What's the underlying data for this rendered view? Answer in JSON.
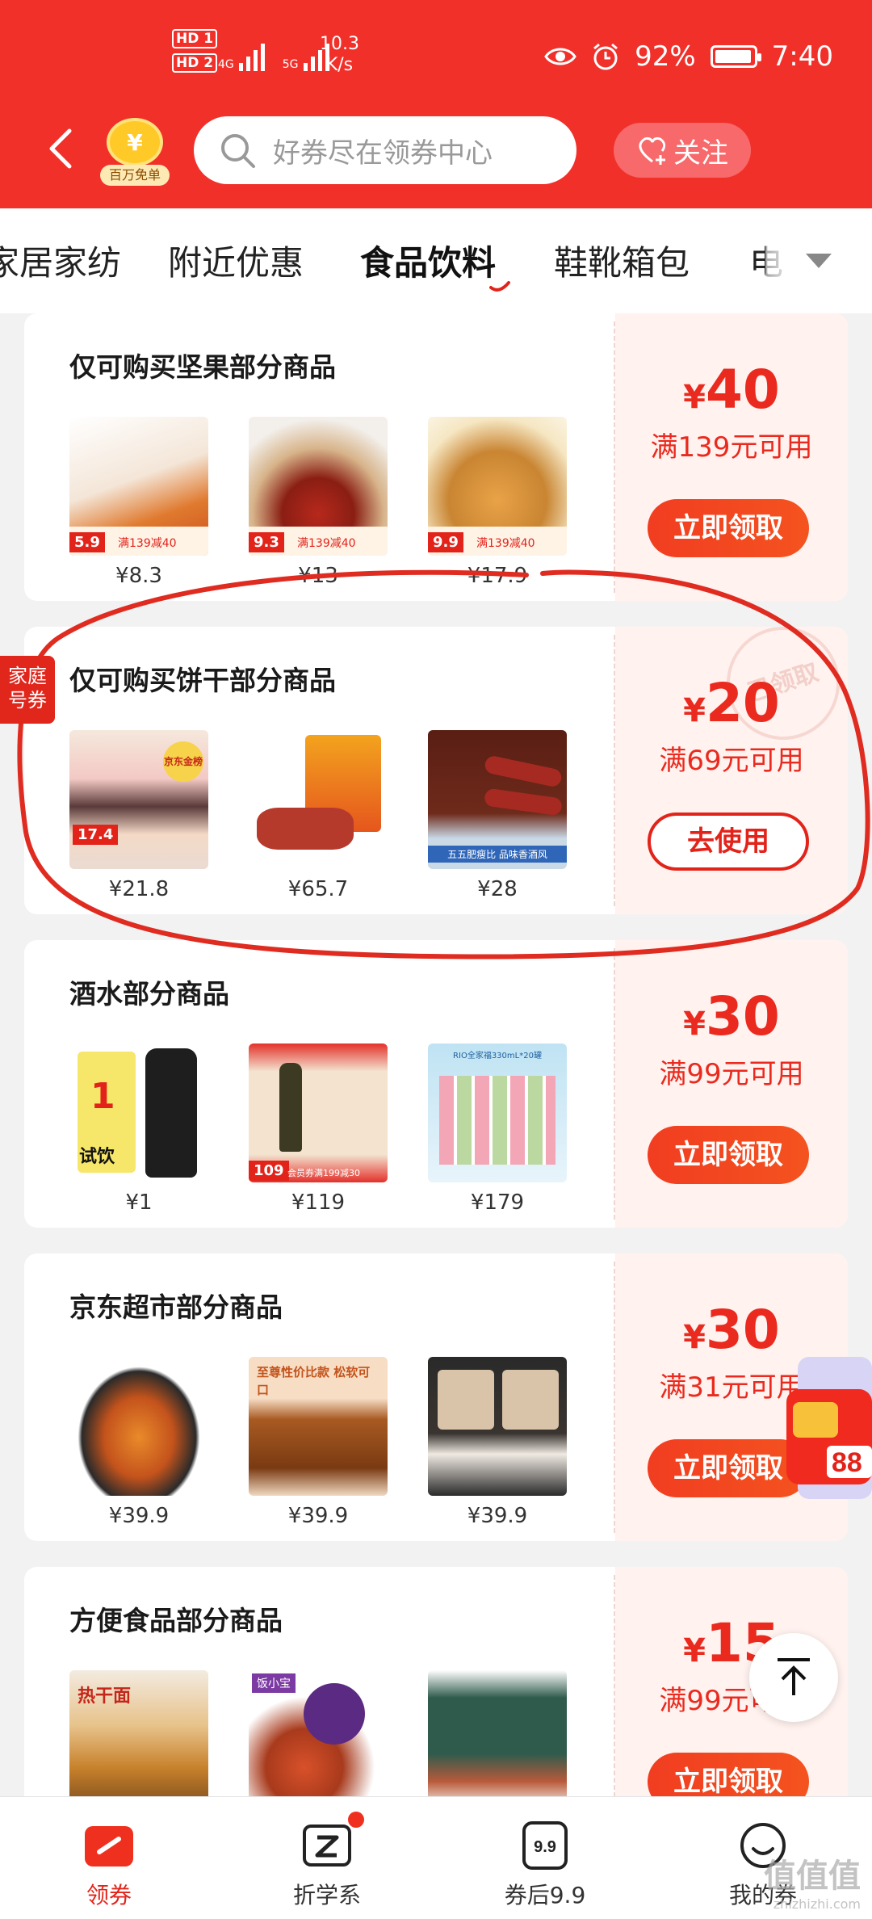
{
  "status_bar": {
    "hd1": "HD 1",
    "hd2": "HD 2",
    "net1": "4G",
    "net2": "5G",
    "speed_value": "10.3",
    "speed_unit": "K/s",
    "battery": "92%",
    "time": "7:40"
  },
  "header": {
    "badge_label": "百万免单",
    "search_placeholder": "好券尽在领券中心",
    "follow_label": "关注"
  },
  "categories": {
    "items": [
      "家居家纺",
      "附近优惠",
      "食品饮料",
      "鞋靴箱包",
      "电"
    ],
    "active": "食品饮料"
  },
  "coupons": [
    {
      "title": "仅可购买坚果部分商品",
      "yen": "¥",
      "amount": "40",
      "condition": "满139元可用",
      "button": "立即领取",
      "products": [
        {
          "price": "¥8.3",
          "tag_price": "5.9",
          "tag_text": "满139减40"
        },
        {
          "price": "¥13",
          "tag_price": "9.3",
          "tag_text": "满139减40"
        },
        {
          "price": "¥17.9",
          "tag_price": "9.9",
          "tag_text": "满139减40"
        }
      ]
    },
    {
      "title": "仅可购买饼干部分商品",
      "yen": "¥",
      "amount": "20",
      "condition": "满69元可用",
      "button": "去使用",
      "stamp": "已领取",
      "family_tag": "家庭号券",
      "products": [
        {
          "price": "¥21.8",
          "tag_price": "17.4",
          "tag_text": "京东金榜"
        },
        {
          "price": "¥65.7",
          "tag_price": "",
          "tag_text": ""
        },
        {
          "price": "¥28",
          "tag_price": "",
          "tag_text": "五五肥瘦比 品味香酒风"
        }
      ]
    },
    {
      "title": "酒水部分商品",
      "yen": "¥",
      "amount": "30",
      "condition": "满99元可用",
      "button": "立即领取",
      "products": [
        {
          "price": "¥1",
          "tag_price": "1",
          "tag_text": "试饮"
        },
        {
          "price": "¥119",
          "tag_price": "109",
          "tag_text": "会员券满199减30"
        },
        {
          "price": "¥179",
          "tag_price": "",
          "tag_text": "RIO全家福330mL*20罐"
        }
      ]
    },
    {
      "title": "京东超市部分商品",
      "yen": "¥",
      "amount": "30",
      "condition": "满31元可用",
      "button": "立即领取",
      "products": [
        {
          "price": "¥39.9",
          "tag_price": "",
          "tag_text": ""
        },
        {
          "price": "¥39.9",
          "tag_price": "",
          "tag_text": "至尊性价比款 松软可口"
        },
        {
          "price": "¥39.9",
          "tag_price": "",
          "tag_text": ""
        }
      ]
    },
    {
      "title": "方便食品部分商品",
      "yen": "¥",
      "amount": "15",
      "condition": "满99元可用",
      "button": "立即领取",
      "products": [
        {
          "price": "",
          "tag_price": "",
          "tag_text": "热干面"
        },
        {
          "price": "",
          "tag_price": "",
          "tag_text": "饭小宝"
        },
        {
          "price": "",
          "tag_price": "",
          "tag_text": ""
        }
      ]
    }
  ],
  "floating_badge": "88",
  "bottom_nav": [
    {
      "label": "领券",
      "icon": "coupon-icon"
    },
    {
      "label": "折学系",
      "icon": "z-icon"
    },
    {
      "label": "券后9.9",
      "icon": "nine-nine-icon",
      "icon_text": "9.9"
    },
    {
      "label": "我的券",
      "icon": "smile-icon"
    }
  ],
  "watermark": {
    "text": "值值值",
    "url": "zhizhizhi.com"
  },
  "colors": {
    "brand": "#f1302a",
    "accent": "#e2231a",
    "coupon_bg": "#fff2ef"
  }
}
